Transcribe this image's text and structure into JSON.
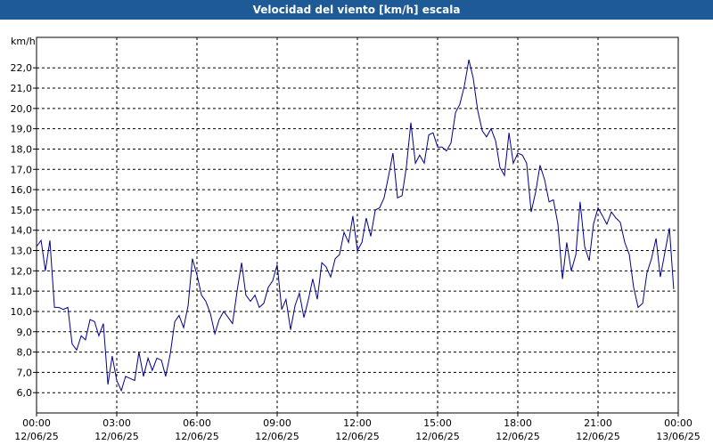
{
  "chart_data": {
    "type": "line",
    "title": "Velocidad del viento [km/h] escala",
    "ylabel": "km/h",
    "xlabel": "",
    "ylim": [
      5.0,
      23.5
    ],
    "xlim_hours": [
      0,
      24
    ],
    "y_ticks": [
      "6,0",
      "7,0",
      "8,0",
      "9,0",
      "10,0",
      "11,0",
      "12,0",
      "13,0",
      "14,0",
      "15,0",
      "16,0",
      "17,0",
      "18,0",
      "19,0",
      "20,0",
      "21,0",
      "22,0"
    ],
    "x_ticks": [
      {
        "time": "00:00",
        "date": "12/06/25"
      },
      {
        "time": "03:00",
        "date": "12/06/25"
      },
      {
        "time": "06:00",
        "date": "12/06/25"
      },
      {
        "time": "09:00",
        "date": "12/06/25"
      },
      {
        "time": "12:00",
        "date": "12/06/25"
      },
      {
        "time": "15:00",
        "date": "12/06/25"
      },
      {
        "time": "18:00",
        "date": "12/06/25"
      },
      {
        "time": "21:00",
        "date": "12/06/25"
      },
      {
        "time": "00:00",
        "date": "13/06/25"
      }
    ],
    "grid": true,
    "line_color": "#00008b",
    "series": [
      {
        "x_hours": [
          0.0,
          0.17,
          0.33,
          0.5,
          0.67,
          0.83,
          1.0,
          1.17,
          1.33,
          1.5,
          1.67,
          1.83,
          2.0,
          2.17,
          2.33,
          2.5,
          2.67,
          2.83,
          3.0,
          3.17,
          3.33,
          3.5,
          3.67,
          3.83,
          4.0,
          4.17,
          4.33,
          4.5,
          4.67,
          4.83,
          5.0,
          5.17,
          5.33,
          5.5,
          5.67,
          5.83,
          6.0,
          6.17,
          6.33,
          6.5,
          6.67,
          6.83,
          7.0,
          7.17,
          7.33,
          7.5,
          7.67,
          7.83,
          8.0,
          8.17,
          8.33,
          8.5,
          8.67,
          8.83,
          9.0,
          9.17,
          9.33,
          9.5,
          9.67,
          9.83,
          10.0,
          10.17,
          10.33,
          10.5,
          10.67,
          10.83,
          11.0,
          11.17,
          11.33,
          11.5,
          11.67,
          11.83,
          12.0,
          12.17,
          12.33,
          12.5,
          12.67,
          12.83,
          13.0,
          13.17,
          13.33,
          13.5,
          13.67,
          13.83,
          14.0,
          14.17,
          14.33,
          14.5,
          14.67,
          14.83,
          15.0,
          15.17,
          15.33,
          15.5,
          15.67,
          15.83,
          16.0,
          16.17,
          16.33,
          16.5,
          16.67,
          16.83,
          17.0,
          17.17,
          17.33,
          17.5,
          17.67,
          17.83,
          18.0,
          18.17,
          18.33,
          18.5,
          18.67,
          18.83,
          19.0,
          19.17,
          19.33,
          19.5,
          19.67,
          19.83,
          20.0,
          20.17,
          20.33,
          20.5,
          20.67,
          20.83,
          21.0,
          21.17,
          21.33,
          21.5,
          21.67,
          21.83,
          22.0,
          22.17,
          22.33,
          22.5,
          22.67,
          22.83,
          23.0,
          23.17,
          23.33,
          23.5,
          23.67,
          23.83
        ],
        "values": [
          13.2,
          13.5,
          12.0,
          13.5,
          10.2,
          10.2,
          10.1,
          10.2,
          8.4,
          8.1,
          8.8,
          8.6,
          9.6,
          9.5,
          8.8,
          9.4,
          6.4,
          7.8,
          6.6,
          6.1,
          6.8,
          6.7,
          6.6,
          8.0,
          6.8,
          7.7,
          7.1,
          7.7,
          7.6,
          6.8,
          7.9,
          9.5,
          9.8,
          9.2,
          10.3,
          12.6,
          11.8,
          10.8,
          10.5,
          9.9,
          8.9,
          9.6,
          10.0,
          9.7,
          9.4,
          11.0,
          12.4,
          10.8,
          10.5,
          10.8,
          10.2,
          10.4,
          11.2,
          11.5,
          12.3,
          10.1,
          10.6,
          9.1,
          10.3,
          10.9,
          9.7,
          10.6,
          11.6,
          10.6,
          12.4,
          12.2,
          11.7,
          12.6,
          12.8,
          13.9,
          13.4,
          14.7,
          13.0,
          13.4,
          14.6,
          13.7,
          15.0,
          15.1,
          15.6,
          16.7,
          17.8,
          15.6,
          15.7,
          17.1,
          19.3,
          17.3,
          17.7,
          17.3,
          18.7,
          18.8,
          18.1,
          18.1,
          17.9,
          18.3,
          19.8,
          20.2,
          21.1,
          22.4,
          21.5,
          19.9,
          18.9,
          18.6,
          19.0,
          18.4,
          17.1,
          16.7,
          18.8,
          17.3,
          17.8,
          17.7,
          17.3,
          14.9,
          15.9,
          17.2,
          16.5,
          15.4,
          15.5,
          14.3,
          11.6,
          13.4,
          12.0,
          12.8,
          15.4,
          13.2,
          12.5,
          14.3,
          15.1,
          14.7,
          14.3,
          14.9,
          14.6,
          14.4,
          13.4,
          12.8,
          11.2,
          10.2,
          10.4,
          11.9,
          12.6,
          13.6,
          11.7,
          12.9,
          14.1,
          11.1
        ]
      }
    ]
  }
}
